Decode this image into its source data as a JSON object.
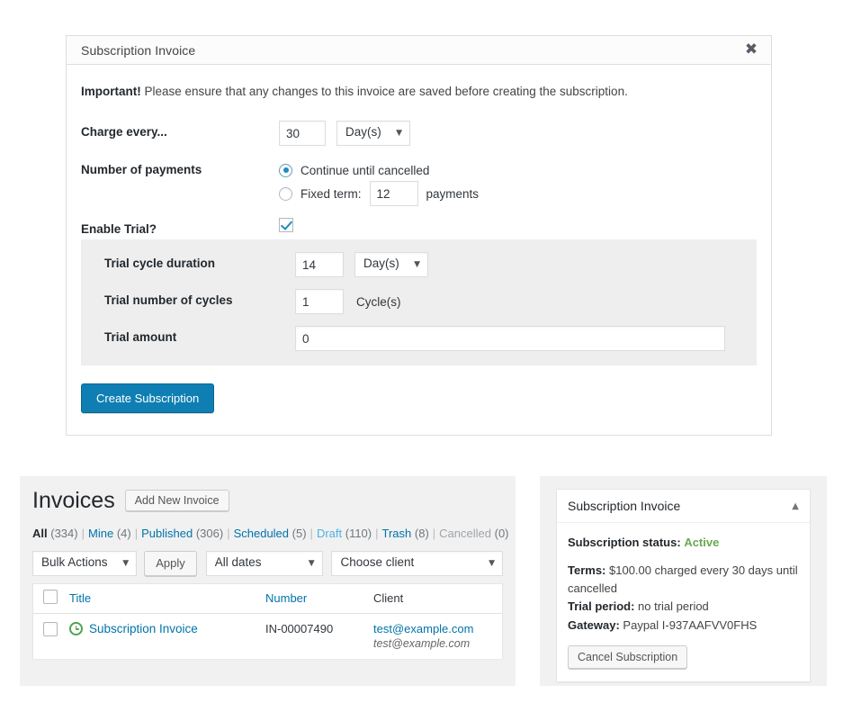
{
  "modal": {
    "title": "Subscription Invoice",
    "close_icon": "close-icon",
    "notice_strong": "Important!",
    "notice_rest": " Please ensure that any changes to this invoice are saved before creating the subscription.",
    "charge_every_label": "Charge every...",
    "charge_every_value": "30",
    "charge_every_unit": "Day(s)",
    "number_of_payments_label": "Number of payments",
    "continue_label": "Continue until cancelled",
    "fixed_term_label": "Fixed term:",
    "fixed_term_value": "12",
    "payments_label": "payments",
    "enable_trial_label": "Enable Trial?",
    "trial_cycle_duration_label": "Trial cycle duration",
    "trial_cycle_duration_value": "14",
    "trial_cycle_duration_unit": "Day(s)",
    "trial_number_label": "Trial number of cycles",
    "trial_number_value": "1",
    "trial_number_unit": "Cycle(s)",
    "trial_amount_label": "Trial amount",
    "trial_amount_value": "0",
    "create_button": "Create Subscription",
    "caret_icon": "chevron-down-icon"
  },
  "list": {
    "title": "Invoices",
    "add_new_button": "Add New Invoice",
    "filters": [
      {
        "label": "All",
        "count": "(334)",
        "state": "current"
      },
      {
        "label": "Mine",
        "count": "(4)",
        "state": "link"
      },
      {
        "label": "Published",
        "count": "(306)",
        "state": "link"
      },
      {
        "label": "Scheduled",
        "count": "(5)",
        "state": "link"
      },
      {
        "label": "Draft",
        "count": "(110)",
        "state": "soft"
      },
      {
        "label": "Trash",
        "count": "(8)",
        "state": "link"
      },
      {
        "label": "Cancelled",
        "count": "(0)",
        "state": "muted"
      }
    ],
    "bulk_actions": "Bulk Actions",
    "apply_button": "Apply",
    "all_dates": "All dates",
    "choose_client": "Choose client",
    "columns": {
      "title": "Title",
      "number": "Number",
      "client": "Client"
    },
    "rows": [
      {
        "title": "Subscription Invoice",
        "status_icon": "clock-icon",
        "number": "IN-00007490",
        "client_email": "test@example.com",
        "client_sub": "test@example.com"
      }
    ]
  },
  "sidebar": {
    "metabox_title": "Subscription Invoice",
    "toggle_icon": "chevron-up-icon",
    "status_label": "Subscription status:",
    "status_value": "Active",
    "terms_label": "Terms:",
    "terms_value": " $100.00 charged every 30 days until cancelled",
    "trial_label": "Trial period:",
    "trial_value": " no trial period",
    "gateway_label": "Gateway:",
    "gateway_value": " Paypal I-937AAFVV0FHS",
    "cancel_button": "Cancel Subscription"
  },
  "colors": {
    "primary_button": "#0f7fb3",
    "link": "#0073aa",
    "status_active": "#6aa84f",
    "clock_icon": "#4fa34f",
    "panel_bg": "#f1f1f1",
    "trial_bg": "#eeeeee"
  }
}
